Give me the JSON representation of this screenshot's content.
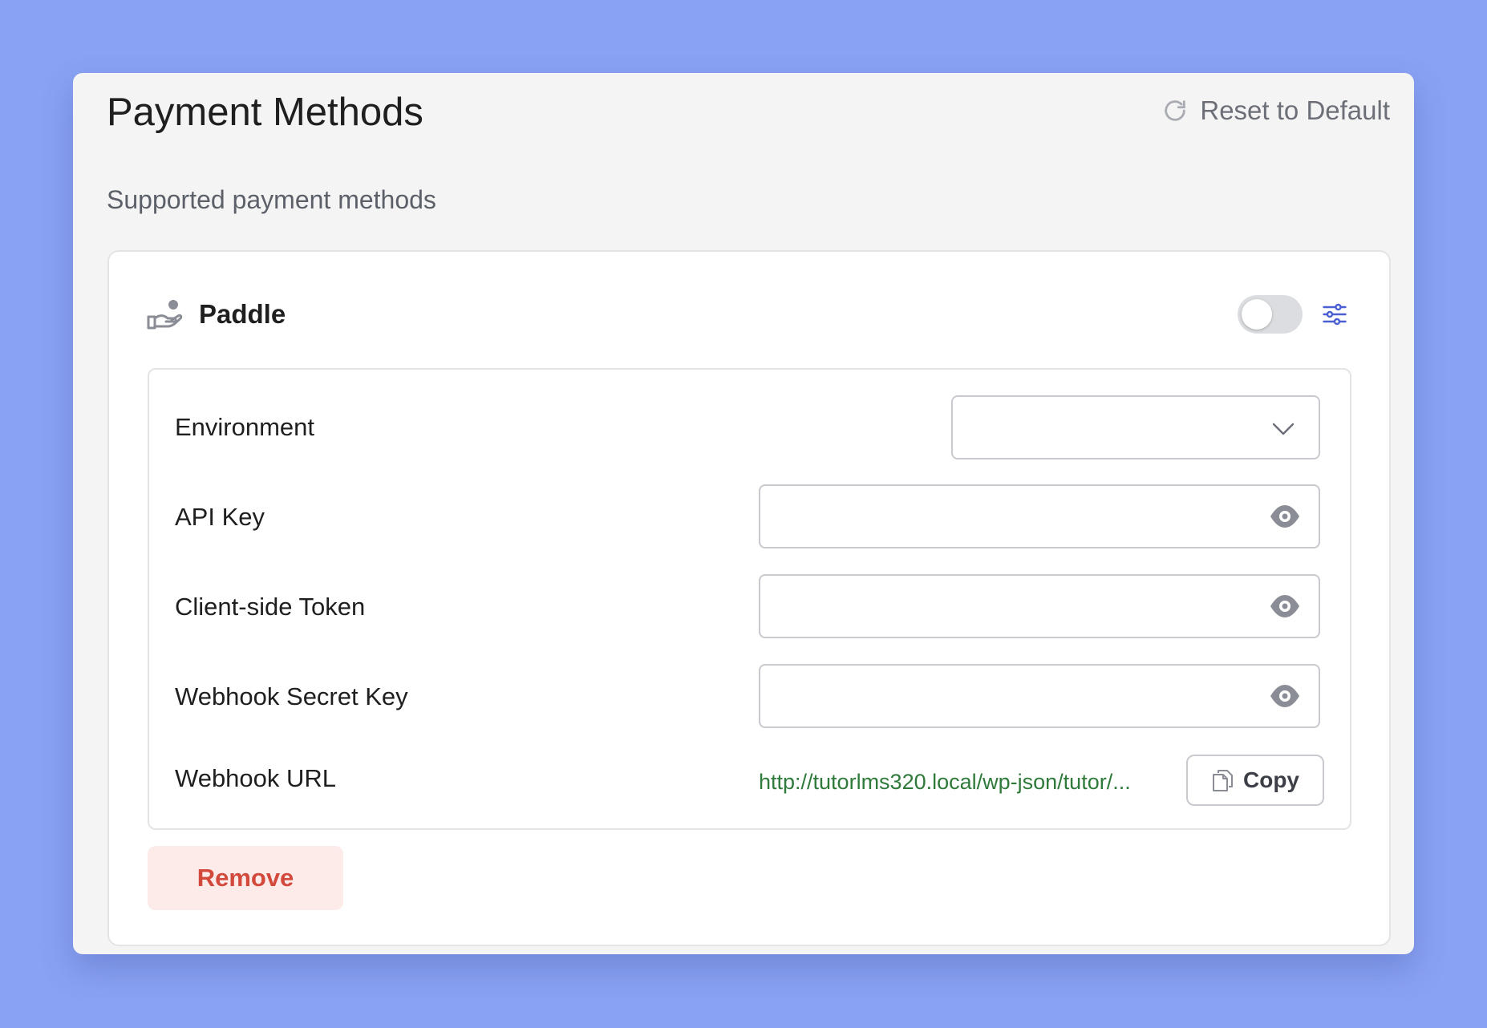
{
  "page": {
    "title": "Payment Methods",
    "reset_label": "Reset to Default",
    "section_label": "Supported payment methods"
  },
  "method": {
    "name": "Paddle",
    "enabled": false,
    "fields": {
      "environment_label": "Environment",
      "environment_value": "",
      "api_key_label": "API Key",
      "api_key_value": "",
      "client_token_label": "Client-side Token",
      "client_token_value": "",
      "webhook_secret_label": "Webhook Secret Key",
      "webhook_secret_value": "",
      "webhook_url_label": "Webhook URL",
      "webhook_url_value": "http://tutorlms320.local/wp-json/tutor/..."
    },
    "copy_label": "Copy",
    "remove_label": "Remove"
  },
  "icons": {
    "reset": "refresh-icon",
    "method": "hand-coin-icon",
    "settings": "sliders-icon",
    "dropdown": "chevron-down-icon",
    "reveal": "eye-icon",
    "copy": "copy-icon"
  },
  "colors": {
    "background": "#8aa2f3",
    "accent": "#4a5fd1",
    "url_green": "#2f7a3b",
    "danger": "#d34a3c",
    "danger_bg": "#fdebea"
  }
}
